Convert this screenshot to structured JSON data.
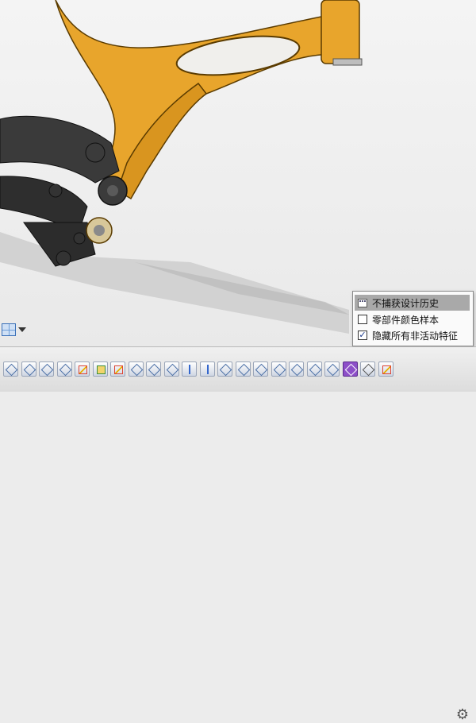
{
  "popup_menu": {
    "items": [
      {
        "label": "不捕获设计历史",
        "checked": null,
        "highlighted": true,
        "icon": "design-history-icon"
      },
      {
        "label": "零部件颜色样本",
        "checked": false,
        "highlighted": false,
        "icon": "checkbox"
      },
      {
        "label": "隐藏所有非活动特征",
        "checked": true,
        "highlighted": false,
        "icon": "checkbox"
      }
    ],
    "check_glyph": "✓"
  },
  "toolbar": {
    "tools": [
      "joint-icon",
      "joint-icon",
      "joint-icon",
      "joint-icon",
      "sketch-icon",
      "extrude-icon",
      "sketch-icon",
      "body-icon",
      "body-icon",
      "body-icon",
      "move-icon",
      "move-icon",
      "box-icon",
      "box-icon",
      "mirror-icon",
      "hole-icon",
      "hole-icon",
      "shell-icon",
      "component-icon",
      "purple-tool-icon",
      "home-icon",
      "sketch-icon"
    ],
    "settings_glyph": "⚙"
  },
  "colors": {
    "frame_orange": "#e8a52c",
    "frame_dark": "#3a3a3a",
    "highlight_row": "#a9a9a9",
    "check_blue": "#1b3a8a"
  }
}
